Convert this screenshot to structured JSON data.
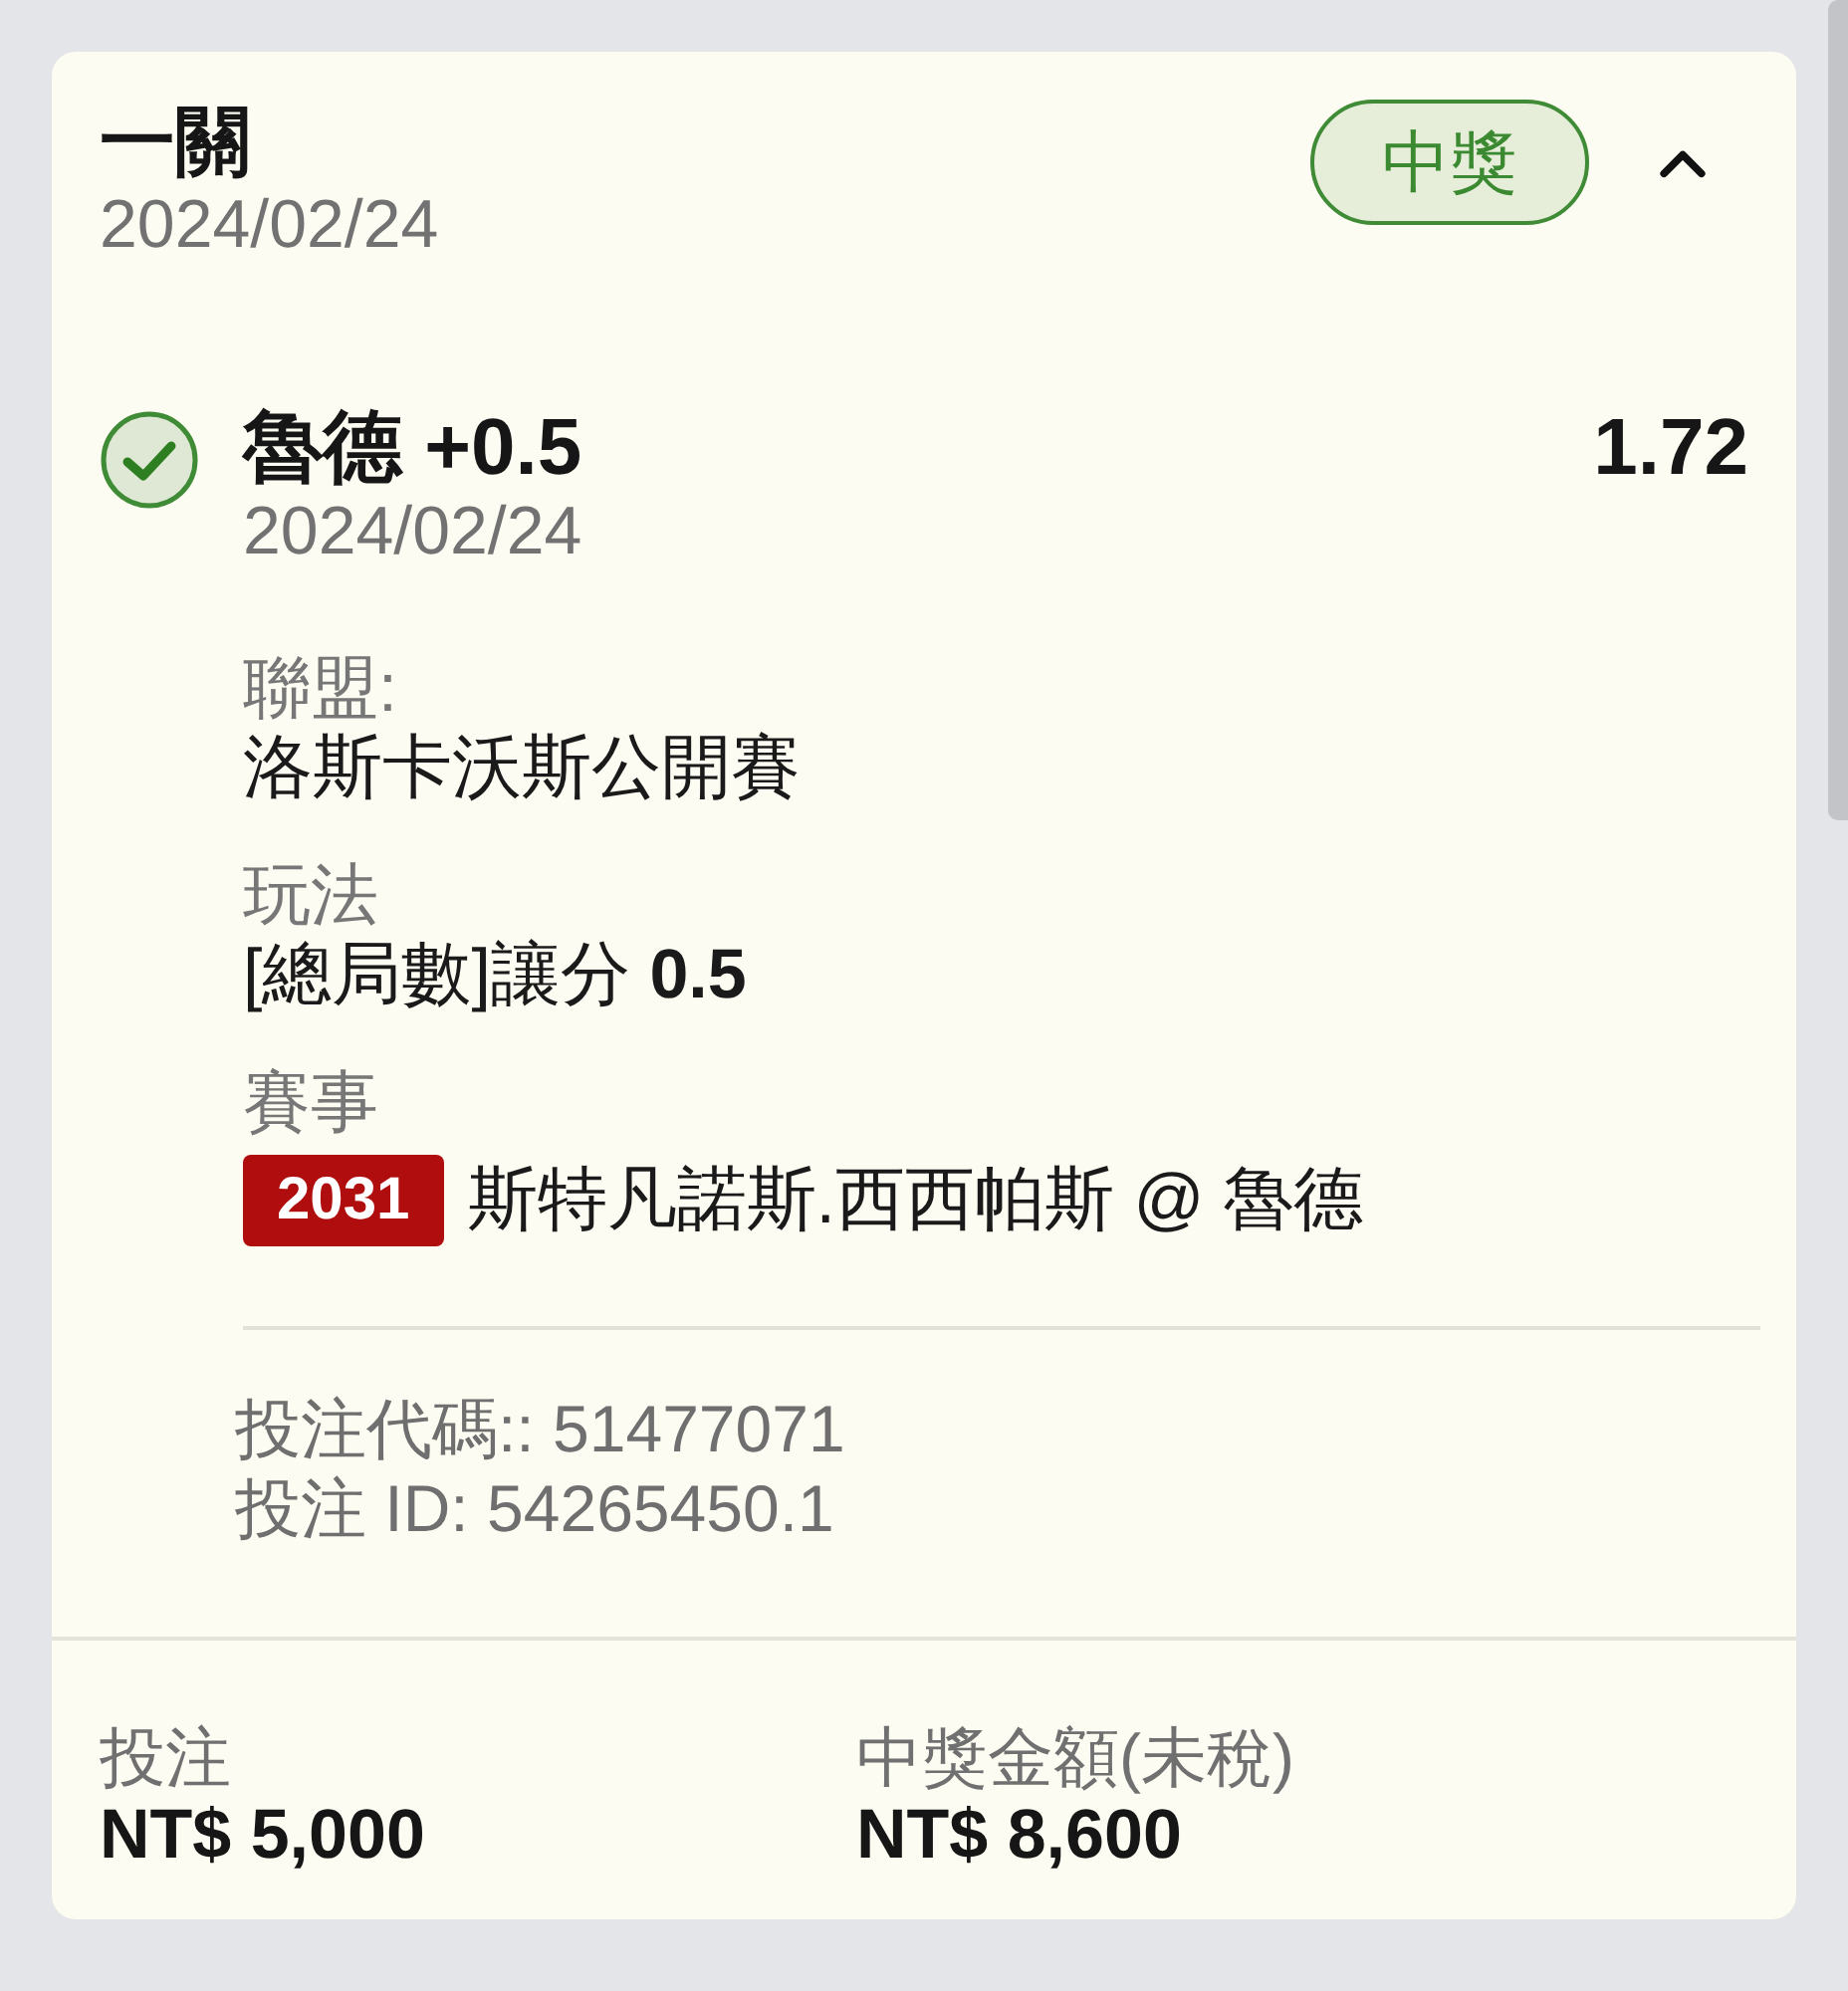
{
  "bet": {
    "title": "一關",
    "date": "2024/02/24",
    "badge": "中獎",
    "expanded": true
  },
  "selection": {
    "won": true,
    "pick": "魯德 +0.5",
    "date": "2024/02/24",
    "odds": "1.72"
  },
  "details": [
    {
      "kind": "text",
      "label": "聯盟:",
      "value": "洛斯卡沃斯公開賽"
    },
    {
      "kind": "text",
      "label": "玩法",
      "value": "[總局數]讓分 **0.5**"
    },
    {
      "kind": "match",
      "label": "賽事",
      "match_code": "2031",
      "value": "斯特凡諾斯.西西帕斯 @ 魯德"
    }
  ],
  "references": [
    "投注代碼:: 51477071",
    "投注 ID: 54265450.1"
  ],
  "totals": [
    {
      "label": "投注",
      "amount": "NT$ 5,000"
    },
    {
      "label": "中獎金額(未稅)",
      "amount": "NT$ 8,600"
    }
  ]
}
